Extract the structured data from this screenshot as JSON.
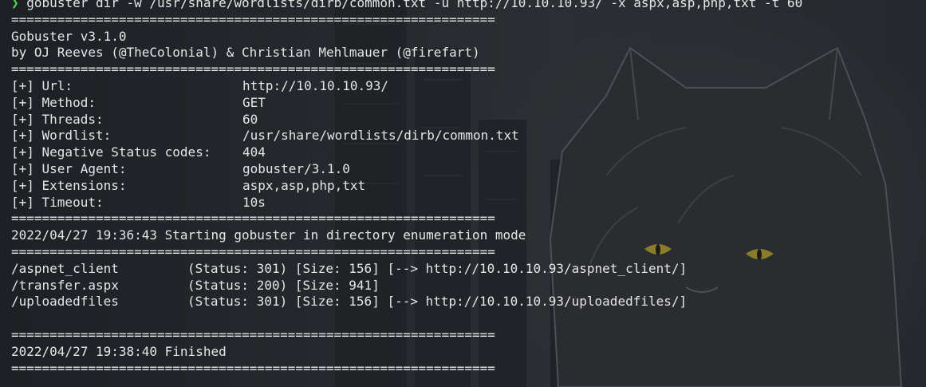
{
  "command": {
    "prompt_symbol": "❯",
    "text": "gobuster dir -w /usr/share/wordlists/dirb/common.txt -u http://10.10.10.93/ -x aspx,asp,php,txt -t 60"
  },
  "separator": "===============================================================",
  "banner": {
    "title": "Gobuster v3.1.0",
    "authors": "by OJ Reeves (@TheColonial) & Christian Mehlmauer (@firefart)"
  },
  "config": [
    {
      "key": "[+] Url:",
      "value": "http://10.10.10.93/"
    },
    {
      "key": "[+] Method:",
      "value": "GET"
    },
    {
      "key": "[+] Threads:",
      "value": "60"
    },
    {
      "key": "[+] Wordlist:",
      "value": "/usr/share/wordlists/dirb/common.txt"
    },
    {
      "key": "[+] Negative Status codes:",
      "value": "404"
    },
    {
      "key": "[+] User Agent:",
      "value": "gobuster/3.1.0"
    },
    {
      "key": "[+] Extensions:",
      "value": "aspx,asp,php,txt"
    },
    {
      "key": "[+] Timeout:",
      "value": "10s"
    }
  ],
  "start_message": "2022/04/27 19:36:43 Starting gobuster in directory enumeration mode",
  "results": [
    {
      "path": "/aspnet_client",
      "info": "(Status: 301) [Size: 156] [--> http://10.10.10.93/aspnet_client/]"
    },
    {
      "path": "/transfer.aspx",
      "info": "(Status: 200) [Size: 941]"
    },
    {
      "path": "/uploadedfiles",
      "info": "(Status: 301) [Size: 156] [--> http://10.10.10.93/uploadedfiles/]"
    }
  ],
  "finish_message": "2022/04/27 19:38:40 Finished",
  "colors": {
    "prompt": "#4ade4a",
    "text": "#e6e6e6",
    "background": "#25282c"
  }
}
